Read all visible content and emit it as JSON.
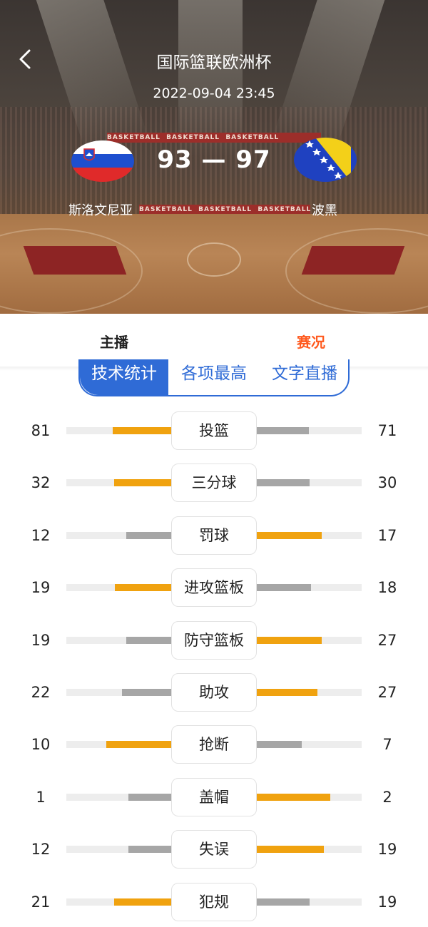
{
  "header": {
    "back_icon": "chevron-left-icon",
    "competition": "国际篮联欧洲杯",
    "datetime": "2022-09-04 23:45",
    "score": "93 — 97",
    "home": {
      "name": "斯洛文尼亚",
      "flag_icon": "slovenia-flag-icon"
    },
    "away": {
      "name": "波黑",
      "flag_icon": "bosnia-herzegovina-flag-icon"
    },
    "banner_text": "BASKETBALL"
  },
  "main_tabs": [
    {
      "label": "主播",
      "active": false
    },
    {
      "label": "赛况",
      "active": true
    }
  ],
  "sub_tabs": [
    {
      "label": "技术统计",
      "active": true
    },
    {
      "label": "各项最高",
      "active": false
    },
    {
      "label": "文字直播",
      "active": false
    }
  ],
  "colors": {
    "leader": "#f0a20f",
    "trailer": "#a6a6a6",
    "track": "#ededed",
    "accent_blue": "#2f6bd6",
    "accent_orange": "#ff5a1f"
  },
  "stats": [
    {
      "label": "投篮",
      "home": "81",
      "away": "71",
      "home_share": 0.53,
      "away_share": 0.47
    },
    {
      "label": "三分球",
      "home": "32",
      "away": "30",
      "home_share": 0.52,
      "away_share": 0.48
    },
    {
      "label": "罚球",
      "home": "12",
      "away": "17",
      "home_share": 0.41,
      "away_share": 0.59
    },
    {
      "label": "进攻篮板",
      "home": "19",
      "away": "18",
      "home_share": 0.51,
      "away_share": 0.49
    },
    {
      "label": "防守篮板",
      "home": "19",
      "away": "27",
      "home_share": 0.41,
      "away_share": 0.59
    },
    {
      "label": "助攻",
      "home": "22",
      "away": "27",
      "home_share": 0.45,
      "away_share": 0.55
    },
    {
      "label": "抢断",
      "home": "10",
      "away": "7",
      "home_share": 0.59,
      "away_share": 0.41
    },
    {
      "label": "盖帽",
      "home": "1",
      "away": "2",
      "home_share": 0.33,
      "away_share": 0.67
    },
    {
      "label": "失误",
      "home": "12",
      "away": "19",
      "home_share": 0.39,
      "away_share": 0.61
    },
    {
      "label": "犯规",
      "home": "21",
      "away": "19",
      "home_share": 0.52,
      "away_share": 0.48
    }
  ]
}
